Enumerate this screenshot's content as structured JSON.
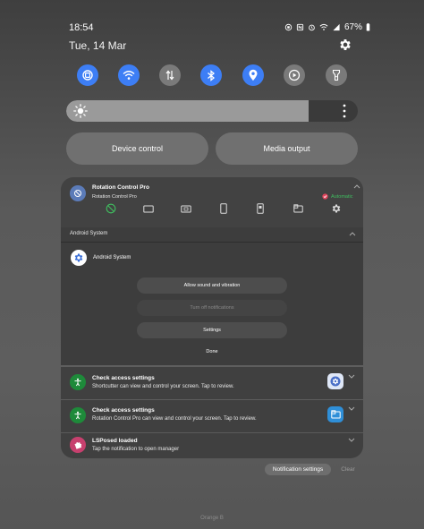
{
  "status_bar": {
    "time": "18:54",
    "battery": "67%",
    "icons": [
      "rotation-lock-icon",
      "nfc-icon",
      "alarm-icon",
      "wifi-icon",
      "signal-icon",
      "battery-icon"
    ]
  },
  "header": {
    "date": "Tue, 14 Mar"
  },
  "quick_toggles": [
    {
      "name": "rotation-icon",
      "state": "on"
    },
    {
      "name": "wifi-icon",
      "state": "on"
    },
    {
      "name": "mobile-data-icon",
      "state": "off"
    },
    {
      "name": "bluetooth-icon",
      "state": "on"
    },
    {
      "name": "location-icon",
      "state": "on"
    },
    {
      "name": "media-play-icon",
      "state": "off"
    },
    {
      "name": "flashlight-icon",
      "state": "off"
    }
  ],
  "brightness": {
    "level": 0.83
  },
  "buttons": {
    "device_control": "Device control",
    "media_output": "Media output"
  },
  "rotation_notification": {
    "app_title": "Rotation Control Pro",
    "subtitle": "Rotation Control Pro",
    "mode_label": "Automatic"
  },
  "android_system": {
    "section_title": "Android System",
    "app_name": "Android System",
    "options": [
      {
        "label": "Allow sound and vibration",
        "enabled": true
      },
      {
        "label": "Turn off notifications",
        "enabled": false
      },
      {
        "label": "Settings",
        "enabled": true
      }
    ],
    "done_label": "Done"
  },
  "notifications": [
    {
      "title": "Check access settings",
      "body": "Shortcutter can view and control your screen. Tap to review."
    },
    {
      "title": "Check access settings",
      "body": "Rotation Control Pro can view and control your screen. Tap to review."
    },
    {
      "title": "LSPosed loaded",
      "body": "Tap the notification to open manager"
    }
  ],
  "footer": {
    "notification_settings": "Notification settings",
    "clear": "Clear",
    "carrier": "Orange B"
  },
  "colors": {
    "accent_blue": "#3d7ef5",
    "toggle_off": "#7a7a7a",
    "green_avatar": "#1e8a3a",
    "lsposed_avatar": "#c7406e",
    "automatic_red": "#e0455c",
    "automatic_green": "#3fbf5f"
  }
}
